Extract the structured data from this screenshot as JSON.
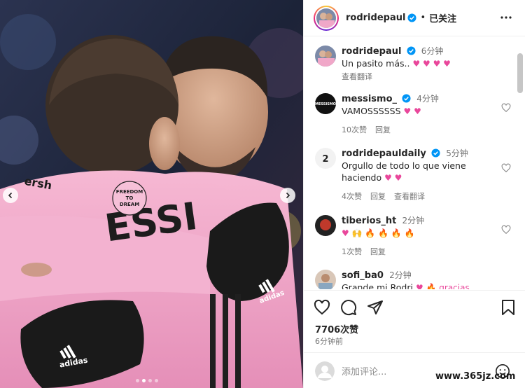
{
  "post": {
    "author": "rodridepaul",
    "separator": "•",
    "follow_state": "已关注"
  },
  "comments": [
    {
      "user": "rodridepaul",
      "verified": true,
      "time": "6分钟",
      "text": "Un pasito más..",
      "emoji": "♥ ♥ ♥ ♥",
      "emoji_color": "#e9479b",
      "actions": [
        "查看翻译"
      ]
    },
    {
      "user": "messismo_",
      "verified": true,
      "time": "4分钟",
      "text": "VAMOSSSSSS",
      "emoji": "♥ ♥",
      "emoji_color": "#e9479b",
      "actions": [
        "10次赞",
        "回复"
      ]
    },
    {
      "user": "rodridepauldaily",
      "verified": true,
      "time": "5分钟",
      "text": "Orgullo de todo lo que viene haciendo",
      "emoji": "♥ ♥",
      "emoji_color": "#e9479b",
      "actions": [
        "4次赞",
        "回复",
        "查看翻译"
      ]
    },
    {
      "user": "tiberios_ht",
      "verified": false,
      "time": "2分钟",
      "text": "",
      "emoji": "♥ 🙌 🔥 🔥 🔥 🔥",
      "emoji_color": "#e9479b",
      "actions": [
        "1次赞",
        "回复"
      ]
    },
    {
      "user": "sofi_ba0",
      "verified": false,
      "time": "2分钟",
      "text": "Grande mi Rodri",
      "emoji": "♥ 🔥 gracias",
      "emoji_color": "#e9479b",
      "actions": []
    }
  ],
  "footer": {
    "likes": "7706次赞",
    "posted": "6分钟前",
    "comment_placeholder": "添加评论..."
  },
  "photo": {
    "jersey_text": "ESSI",
    "patch_text_1": "FREEDOM",
    "patch_text_2": "TO",
    "patch_text_3": "DREAM",
    "back_text": "ersh",
    "glove_brand": "adidas",
    "sleeve_brand": "adidas",
    "jersey_color": "#f1a8c9",
    "glove_color": "#1a1a1a"
  },
  "icons": [
    "heart-icon",
    "comment-icon",
    "share-icon",
    "bookmark-icon",
    "more-icon",
    "verified-icon",
    "emoji-icon"
  ],
  "watermark": "www.365jz.com",
  "accent_verified": "#0095f6"
}
